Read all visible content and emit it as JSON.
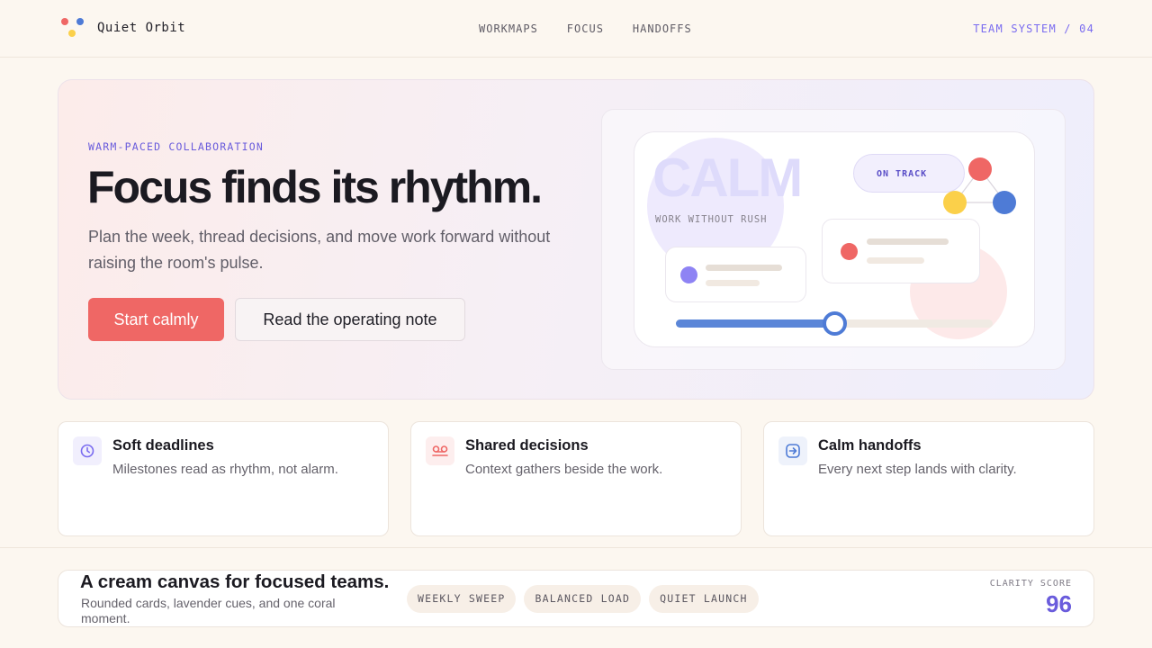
{
  "header": {
    "brand": "Quiet Orbit",
    "nav": [
      "WORKMAPS",
      "FOCUS",
      "HANDOFFS"
    ],
    "team_label": "TEAM SYSTEM / 04"
  },
  "hero": {
    "eyebrow": "WARM-PACED COLLABORATION",
    "title": "Focus finds its rhythm.",
    "subtitle": "Plan the week, thread decisions, and move work forward without raising the room's pulse.",
    "primary_cta": "Start calmly",
    "secondary_cta": "Read the operating note",
    "illustration": {
      "watermark": "CALM",
      "tagline": "WORK WITHOUT RUSH",
      "status_pill": "ON TRACK",
      "progress": 0.5
    }
  },
  "features": [
    {
      "icon": "clock-icon",
      "title": "Soft deadlines",
      "desc": "Milestones read as rhythm, not alarm."
    },
    {
      "icon": "voicemail-icon",
      "title": "Shared decisions",
      "desc": "Context gathers beside the work."
    },
    {
      "icon": "arrow-right-box-icon",
      "title": "Calm handoffs",
      "desc": "Every next step lands with clarity."
    }
  ],
  "band": {
    "title": "A cream canvas for focused teams.",
    "desc": "Rounded cards, lavender cues, and one coral moment.",
    "chips": [
      "WEEKLY SWEEP",
      "BALANCED LOAD",
      "QUIET LAUNCH"
    ],
    "score_label": "CLARITY SCORE",
    "score": "96"
  },
  "colors": {
    "background": "#fcf7f0",
    "coral": "#ef6765",
    "lavender": "#7a6cf0",
    "blue": "#4e7bd6",
    "yellow": "#fbd04a"
  }
}
